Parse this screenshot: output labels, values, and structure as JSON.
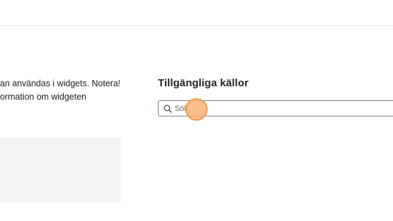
{
  "description": {
    "line1": "an användas i widgets. Notera!",
    "line2": "ormation om widgeten"
  },
  "sources": {
    "title": "Tillgängliga källor",
    "search": {
      "placeholder": "Sök",
      "value": ""
    }
  },
  "colors": {
    "search_border": "#6f8594",
    "click_indicator": "#f19a4c",
    "placeholder_panel": "#f4f4f4"
  }
}
